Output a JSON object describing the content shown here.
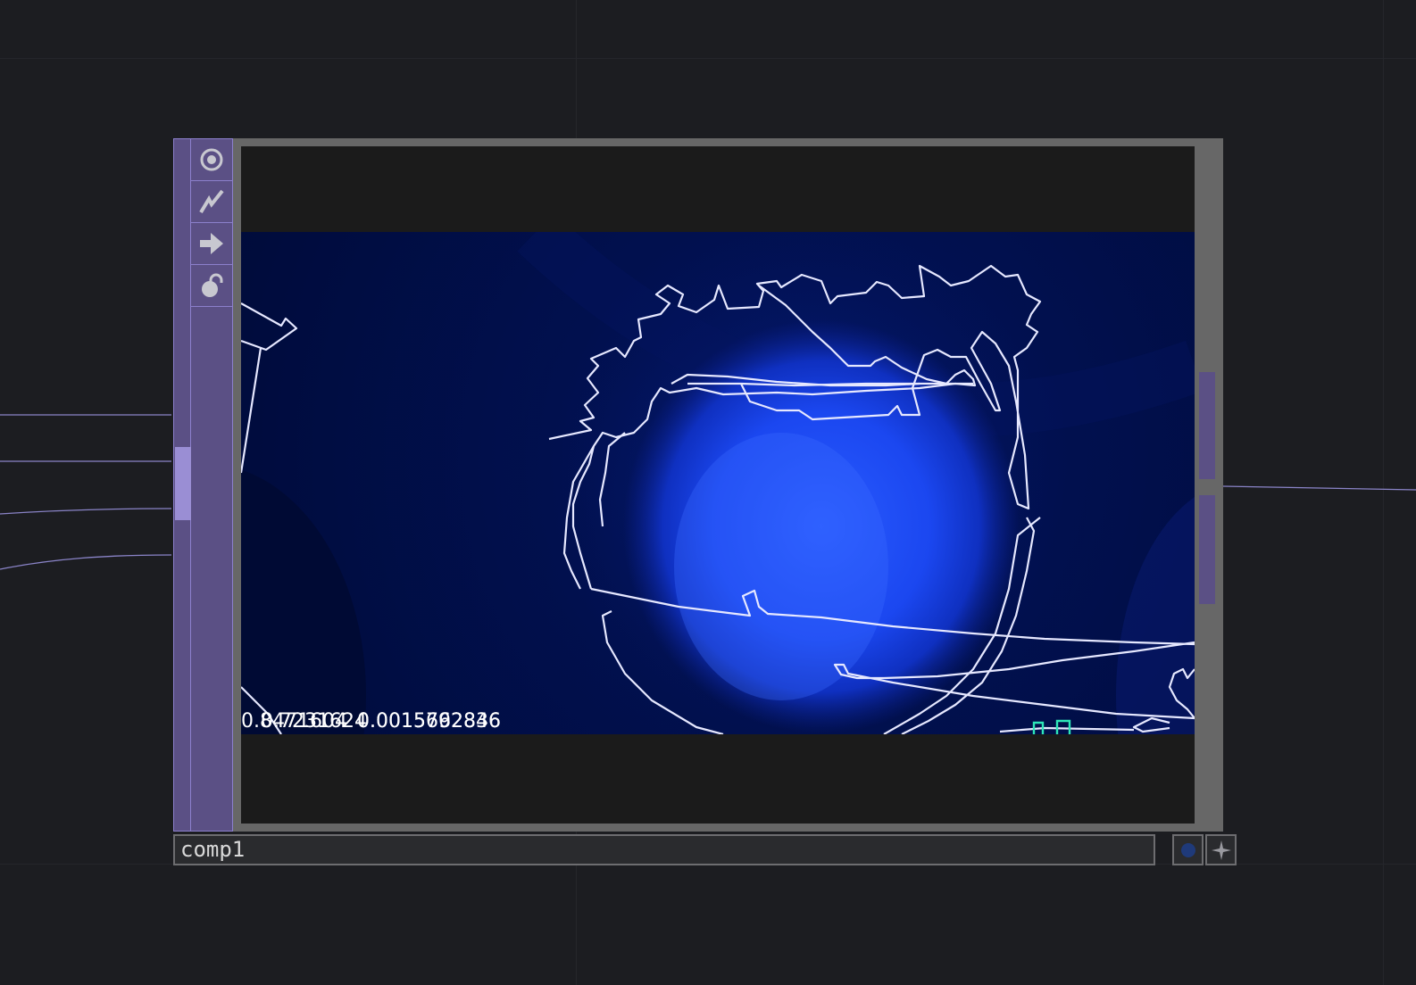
{
  "node": {
    "name": "comp1",
    "readout_values": [
      "0.8471604",
      "0.7231624",
      "0.0015692836",
      "0.0015762846"
    ],
    "flags": [
      {
        "name": "viewer-active-icon",
        "label": ""
      },
      {
        "name": "bypass-icon",
        "label": ""
      },
      {
        "name": "export-icon",
        "label": ""
      },
      {
        "name": "lock-icon",
        "label": ""
      }
    ]
  },
  "colors": {
    "background": "#1c1d21",
    "node_purple": "#5b5085",
    "node_border": "#8c80cc",
    "viewer_frame": "#676767",
    "image_glow": "#1b4fff",
    "outline": "#e6e8ff",
    "histogram": "#2ee6b8"
  }
}
